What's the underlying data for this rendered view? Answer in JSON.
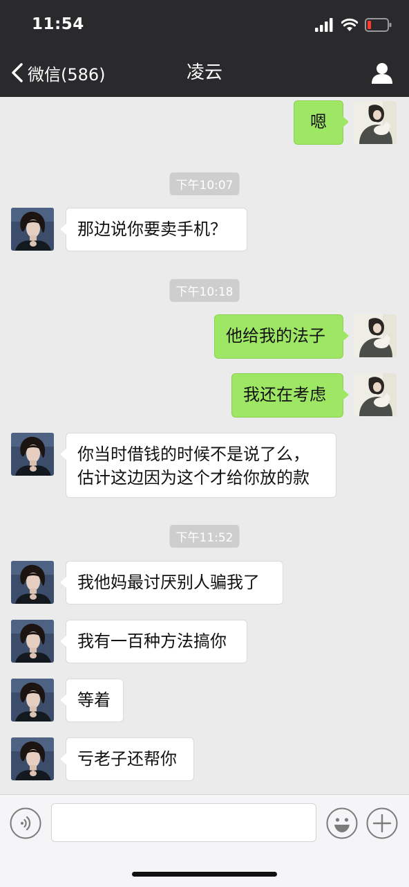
{
  "status_bar": {
    "time": "11:54"
  },
  "nav": {
    "back_label": "微信(586)",
    "title": "凌云"
  },
  "messages": [
    {
      "type": "out",
      "text": "嗯"
    },
    {
      "type": "time",
      "text": "下午10:07"
    },
    {
      "type": "in",
      "text": "那边说你要卖手机？"
    },
    {
      "type": "time",
      "text": "下午10:18"
    },
    {
      "type": "out",
      "text": "他给我的法子"
    },
    {
      "type": "out",
      "text": "我还在考虑"
    },
    {
      "type": "in",
      "line1": "你当时借钱的时候不是说了么，",
      "line2": "估计这边因为这个才给你放的款"
    },
    {
      "type": "time",
      "text": "下午11:52"
    },
    {
      "type": "in",
      "text": "我他妈最讨厌别人骗我了"
    },
    {
      "type": "in",
      "text": "我有一百种方法搞你"
    },
    {
      "type": "in",
      "text": "等着"
    },
    {
      "type": "in",
      "text": "亏老子还帮你"
    }
  ],
  "input": {
    "value": ""
  },
  "colors": {
    "bar": "#2a2a2d",
    "out_bubble": "#9ee765",
    "in_bubble": "#ffffff",
    "chat_bg": "#ebebeb"
  }
}
